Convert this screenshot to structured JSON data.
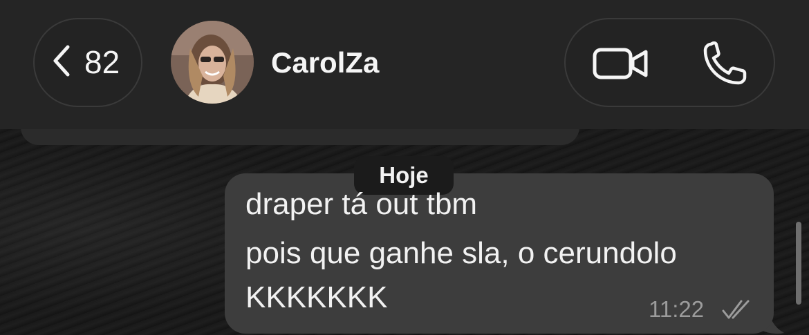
{
  "header": {
    "back_count": "82",
    "contact_name": "CarolZa",
    "icons": {
      "back": "chevron-left-icon",
      "video": "video-camera-icon",
      "call": "phone-icon"
    }
  },
  "chat": {
    "date_separator": "Hoje",
    "messages": [
      {
        "direction": "outgoing",
        "lines": [
          "draper tá out tbm",
          "pois que ganhe sla, o cerundolo",
          "KKKKKKK"
        ],
        "time": "11:22",
        "status": "read-double-check-icon"
      }
    ]
  },
  "colors": {
    "header_bg": "#252525",
    "bubble_outgoing": "#3d3d3d",
    "date_chip": "#1b1b1b",
    "text_primary": "#f2f2f2",
    "text_secondary": "#9c9c9c"
  }
}
